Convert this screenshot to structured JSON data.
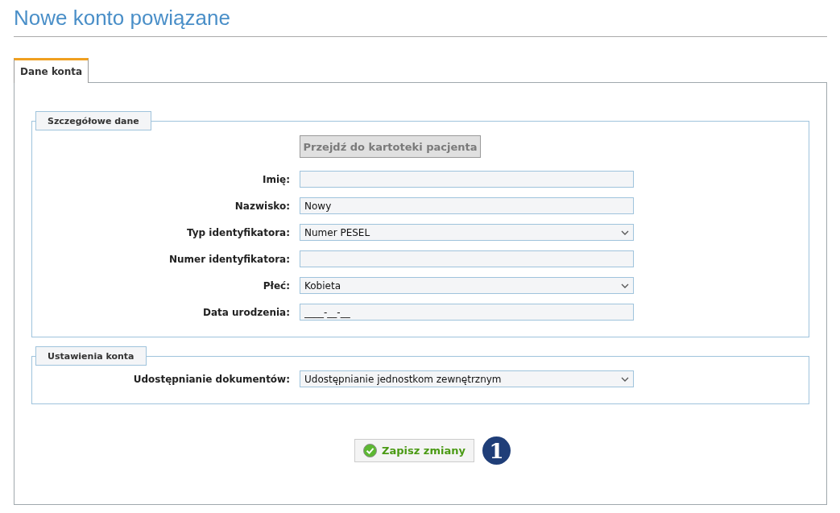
{
  "title": "Nowe konto powiązane",
  "tabs": [
    {
      "label": "Dane konta",
      "selected": true
    }
  ],
  "sections": [
    {
      "legend": "Szczegółowe dane",
      "button": {
        "label": "Przejdź do kartoteki pacjenta",
        "disabled": true
      },
      "fields": [
        {
          "label": "Imię:",
          "kind": "text"
        },
        {
          "label": "Nazwisko:",
          "kind": "text",
          "value": "Nowy"
        },
        {
          "label": "Typ identyfikatora:",
          "kind": "select",
          "value": "Numer PESEL"
        },
        {
          "label": "Numer identyfikatora:",
          "kind": "text"
        },
        {
          "label": "Płeć:",
          "kind": "select",
          "value": "Kobieta"
        },
        {
          "label": "Data urodzenia:",
          "kind": "text",
          "value": "____-__-__"
        }
      ]
    },
    {
      "legend": "Ustawienia konta",
      "fields": [
        {
          "label": "Udostępnianie dokumentów:",
          "kind": "select",
          "value": "Udostępnianie jednostkom zewnętrznym"
        }
      ]
    }
  ],
  "save_button": {
    "label": "Zapisz zmiany"
  },
  "step_badge": "1"
}
